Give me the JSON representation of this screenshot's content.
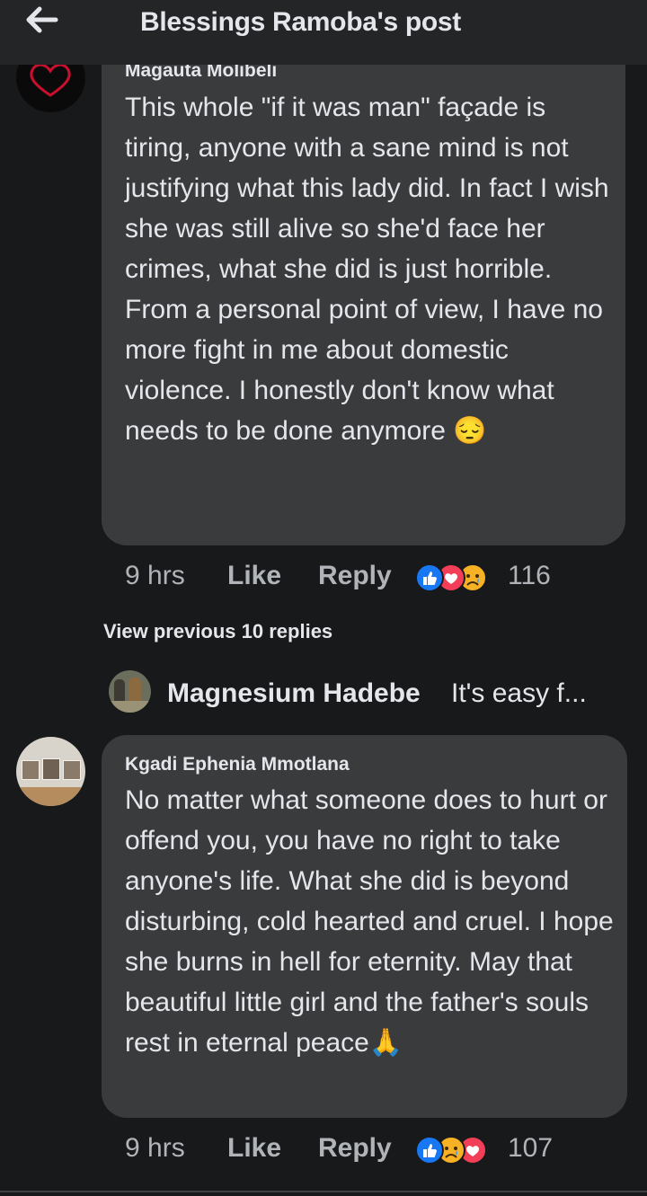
{
  "header": {
    "title": "Blessings Ramoba's post"
  },
  "comments": [
    {
      "author": "Magauta Molibeli",
      "text": "This whole \"if it was man\" façade is tiring, anyone with a sane mind is not justifying what this lady did. In fact I wish she was still alive so she'd face her crimes, what she did is just horrible.\nFrom a personal point of view, I have no more fight in me about domestic violence. I honestly don't know what needs to be done anymore 😔",
      "time": "9 hrs",
      "like_label": "Like",
      "reply_label": "Reply",
      "reactions": [
        "like-reaction",
        "love-reaction",
        "sad-reaction"
      ],
      "reaction_count": "116"
    },
    {
      "author": "Kgadi Ephenia Mmotlana",
      "text": "No matter what someone does to hurt or offend you, you have no right to take anyone's life. What she did is beyond disturbing, cold hearted and cruel. I hope she burns in hell for eternity. May that beautiful little girl and the father's souls rest in eternal peace🙏",
      "time": "9 hrs",
      "like_label": "Like",
      "reply_label": "Reply",
      "reactions": [
        "like-reaction",
        "sad-reaction",
        "love-reaction"
      ],
      "reaction_count": "107"
    }
  ],
  "replies": {
    "view_previous": "View previous 10 replies",
    "preview_author": "Magnesium Hadebe",
    "preview_text": "It's easy f..."
  },
  "colors": {
    "background": "#18191a",
    "bubble": "#3a3b3c",
    "text": "#e4e6eb",
    "secondary": "#b0b3b8",
    "like_blue": "#1877f2",
    "love_red": "#f33e58",
    "sad_yellow": "#f7b125"
  }
}
